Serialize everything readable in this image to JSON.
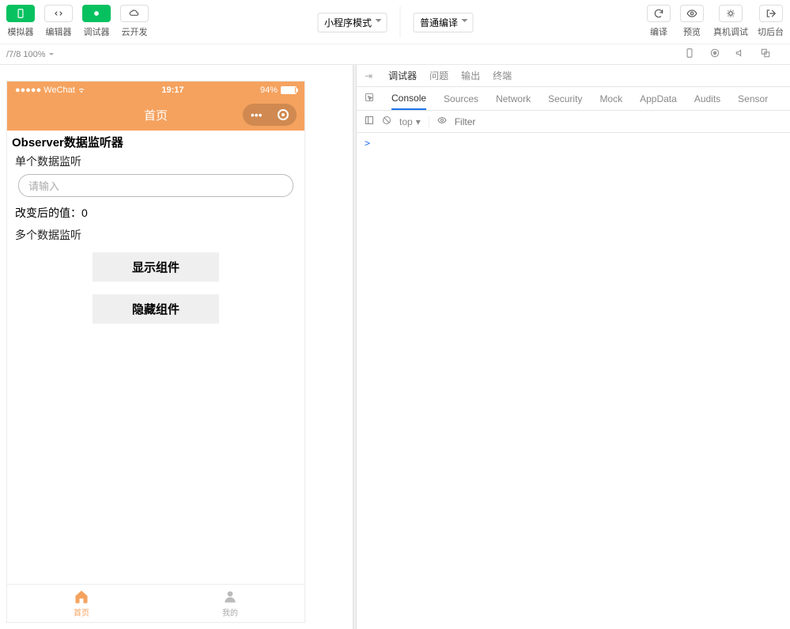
{
  "toolbar": {
    "simulator": "模拟器",
    "editor": "编辑器",
    "debugger": "调试器",
    "cloud_dev": "云开发",
    "mode_select": "小程序模式",
    "compile_select": "普通编译",
    "compile": "编译",
    "preview": "预览",
    "remote_debug": "真机调试",
    "background": "切后台"
  },
  "subbar": {
    "device_label": "/7/8 100%"
  },
  "sim": {
    "carrier": "WeChat",
    "time": "19:17",
    "battery_pct": "94%",
    "nav_title": "首页",
    "h_title": "Observer数据监听器",
    "lbl_single": "单个数据监听",
    "input_placeholder": "请输入",
    "changed_label": "改变后的值：",
    "changed_value": "0",
    "lbl_multi": "多个数据监听",
    "btn_show": "显示组件",
    "btn_hide": "隐藏组件",
    "tab_home": "首页",
    "tab_me": "我的"
  },
  "devtools": {
    "tabs1": [
      "调试器",
      "问题",
      "输出",
      "终端"
    ],
    "tabs2": [
      "Console",
      "Sources",
      "Network",
      "Security",
      "Mock",
      "AppData",
      "Audits",
      "Sensor"
    ],
    "context": "top",
    "filter_placeholder": "Filter",
    "prompt": ">"
  }
}
